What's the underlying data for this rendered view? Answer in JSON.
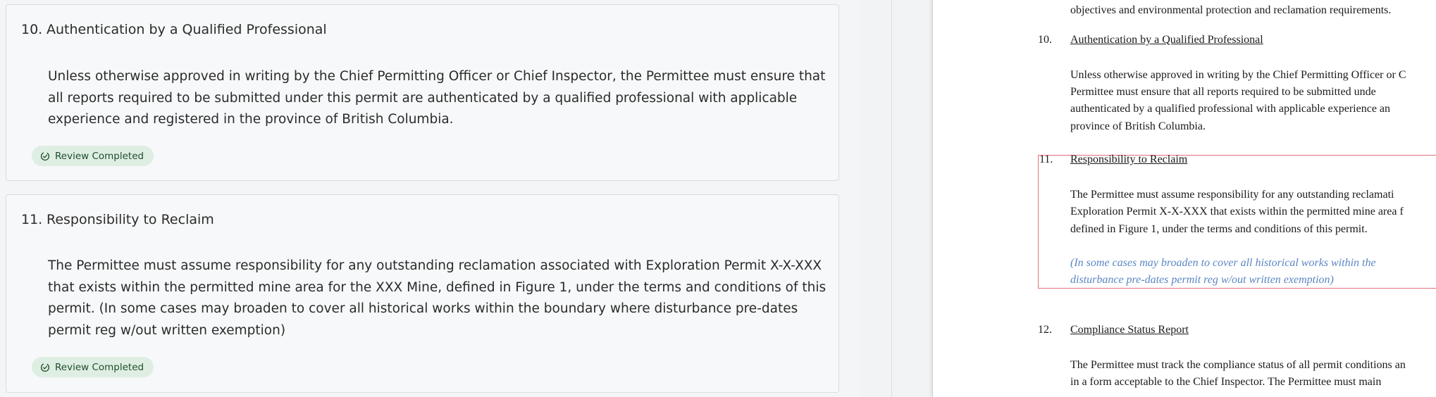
{
  "review_panel": {
    "items": [
      {
        "number": "10.",
        "title": "Authentication by a Qualified Professional",
        "body": "Unless otherwise approved in writing by the Chief Permitting Officer or Chief Inspector, the Permittee must ensure that all reports required to be submitted under this permit are authenticated by a qualified professional with applicable experience and registered in the province of British Columbia.",
        "status": "Review Completed"
      },
      {
        "number": "11.",
        "title": "Responsibility to Reclaim",
        "body": "The Permittee must assume responsibility for any outstanding reclamation associated with Exploration Permit X-X-XXX that exists within the permitted mine area for the XXX Mine, defined in Figure 1, under the terms and conditions of this permit. (In some cases may broaden to cover all historical works within the boundary where disturbance pre-dates permit reg w/out written exemption)",
        "status": "Review Completed"
      }
    ],
    "status_icon": "check-circle-icon",
    "status_color": "#dfeee3"
  },
  "document": {
    "top_fragment": "objectives and environmental protection and reclamation requirements.",
    "sections": [
      {
        "number": "10.",
        "heading": "Authentication by a Qualified Professional",
        "lines": [
          "Unless otherwise approved in writing by the Chief Permitting Officer or C",
          "Permittee must ensure that all reports required to be submitted unde",
          "authenticated by a qualified professional with applicable experience an",
          "province of British Columbia."
        ]
      },
      {
        "number": "11.",
        "heading": "Responsibility to Reclaim",
        "lines": [
          "The Permittee must assume responsibility for any outstanding reclamati",
          "Exploration Permit X-X-XXX that exists within the permitted mine area f",
          "defined in Figure 1, under the terms and conditions of this permit."
        ],
        "italic_lines": [
          "(In some cases may broaden to cover all historical works within the",
          "disturbance pre-dates permit reg w/out written exemption)"
        ]
      },
      {
        "number": "12.",
        "heading": "Compliance Status Report",
        "lines": [
          "The Permittee must track the compliance status of all permit conditions an",
          "in a form acceptable to the Chief Inspector. The Permittee must main"
        ]
      }
    ],
    "highlight_color": "#e0707a",
    "italic_color": "#5b86c5"
  }
}
